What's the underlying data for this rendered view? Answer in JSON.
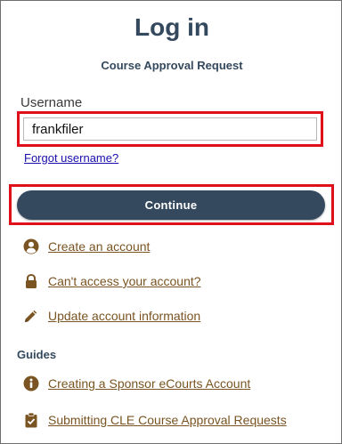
{
  "header": {
    "title": "Log in",
    "subtitle": "Course Approval Request"
  },
  "form": {
    "username_label": "Username",
    "username_value": "frankfiler",
    "forgot_link": "Forgot username?",
    "continue_label": "Continue"
  },
  "links": {
    "create_account": "Create an account",
    "cant_access": "Can't access your account?",
    "update_info": "Update account information"
  },
  "guides": {
    "heading": "Guides",
    "sponsor_account": "Creating a Sponsor eCourts Account",
    "submitting_cle": "Submitting CLE Course Approval Requests"
  },
  "colors": {
    "heading": "#34495e",
    "button_bg": "#34495e",
    "link_brown": "#7a5422",
    "link_blue": "#1a0dab",
    "highlight_red": "#e0101b"
  },
  "icons": {
    "create_account": "user-circle-icon",
    "cant_access": "lock-icon",
    "update_info": "pencil-icon",
    "sponsor_account": "info-circle-icon",
    "submitting_cle": "clipboard-check-icon"
  }
}
